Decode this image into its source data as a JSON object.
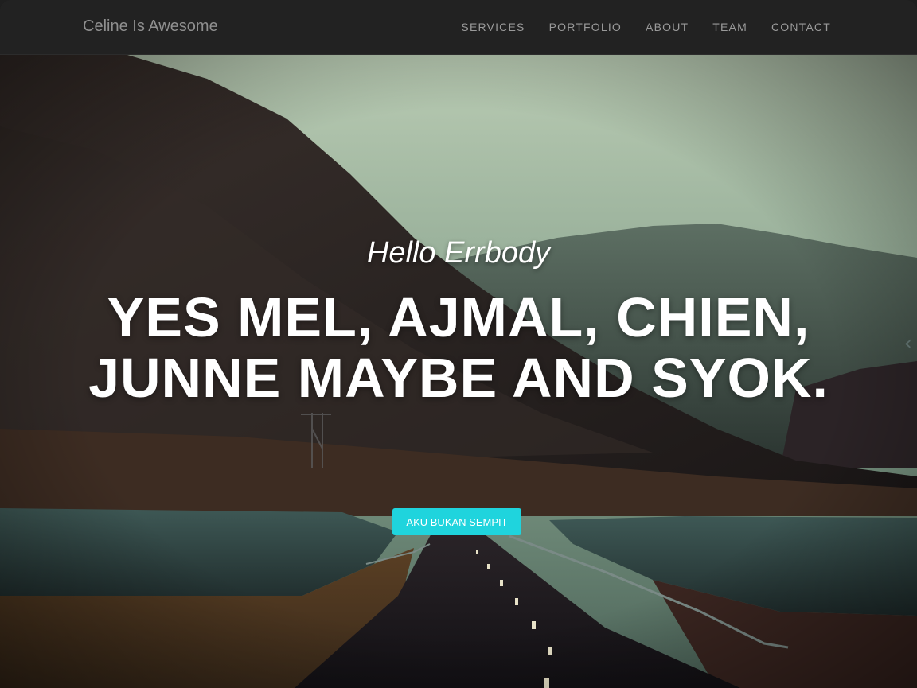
{
  "navbar": {
    "brand": "Celine Is Awesome",
    "links": [
      "SERVICES",
      "PORTFOLIO",
      "ABOUT",
      "TEAM",
      "CONTACT"
    ]
  },
  "hero": {
    "subheading": "Hello Errbody",
    "heading": "YES MEL, AJMAL, CHIEN, JUNNE MAYBE AND SYOK.",
    "button_label": "AKU BUKAN SEMPIT",
    "background_image": "mountain-road-landscape",
    "slider_prev_icon": "chevron-left-icon"
  },
  "colors": {
    "navbar_bg": "#222222",
    "accent": "#1fd4dd",
    "nav_text": "#9a9a9a"
  }
}
